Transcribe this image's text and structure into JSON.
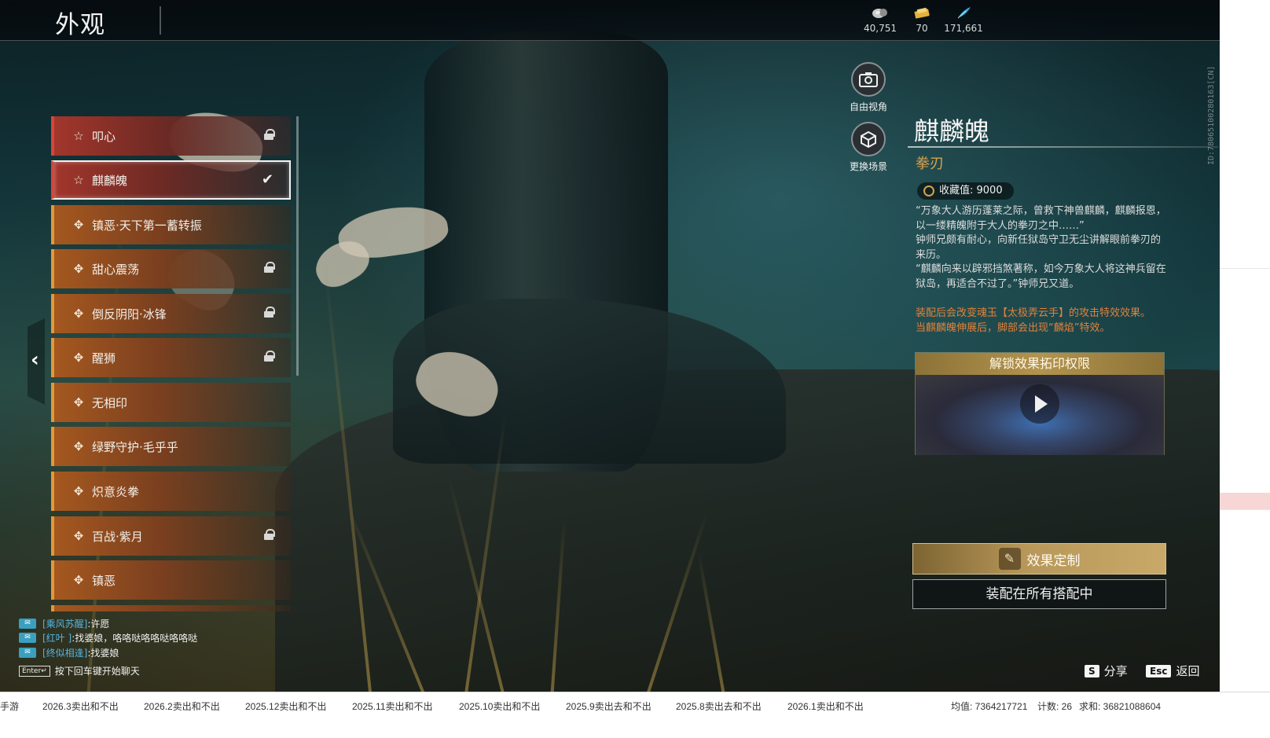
{
  "header": {
    "title": "外观",
    "currencies": [
      {
        "icon": "ore-icon",
        "value": "40,751"
      },
      {
        "icon": "ticket-icon",
        "value": "70"
      },
      {
        "icon": "feather-icon",
        "value": "171,661"
      }
    ]
  },
  "side_id": "ID:78065100280163[CN]",
  "skin_list": [
    {
      "label": "叩心",
      "icon": "star-icon",
      "rarity": "red",
      "locked": true
    },
    {
      "label": "麒麟魄",
      "icon": "star-icon",
      "rarity": "red",
      "selected": true,
      "equipped": true
    },
    {
      "label": "镇恶·天下第一蓄转振",
      "icon": "sparkle-icon",
      "rarity": "orange"
    },
    {
      "label": "甜心震荡",
      "icon": "sparkle-icon",
      "rarity": "orange",
      "locked": true
    },
    {
      "label": "倒反阴阳·冰锋",
      "icon": "sparkle-icon",
      "rarity": "orange",
      "locked": true
    },
    {
      "label": "醒狮",
      "icon": "sparkle-icon",
      "rarity": "orange",
      "locked": true
    },
    {
      "label": "无相印",
      "icon": "sparkle-icon",
      "rarity": "orange"
    },
    {
      "label": "绿野守护·毛乎乎",
      "icon": "sparkle-icon",
      "rarity": "orange"
    },
    {
      "label": "炽意炎拳",
      "icon": "sparkle-icon",
      "rarity": "orange"
    },
    {
      "label": "百战·紫月",
      "icon": "sparkle-icon",
      "rarity": "orange",
      "locked": true
    },
    {
      "label": "镇恶",
      "icon": "sparkle-icon",
      "rarity": "orange"
    }
  ],
  "camera": {
    "free_view_label": "自由视角",
    "change_scene_label": "更换场景"
  },
  "detail": {
    "name": "麒麟魄",
    "type": "拳刃",
    "collect_label": "收藏值: 9000",
    "description": [
      "“万象大人游历蓬莱之际，曾救下神兽麒麟，麒麟报恩，以一缕精魄附于大人的拳刃之中……”",
      "钟师兄颇有耐心，向新任狱岛守卫无尘讲解眼前拳刃的来历。",
      "“麒麟向来以辟邪挡煞著称，如今万象大人将这神兵留在狱岛，再适合不过了。”钟师兄又道。"
    ],
    "effects": [
      "装配后会改变魂玉【太极弄云手】的攻击特效效果。",
      "当麒麟魄伸展后，脚部会出现“麟焰”特效。"
    ],
    "preview_header": "解锁效果拓印权限"
  },
  "buttons": {
    "customize": "效果定制",
    "equip_all": "装配在所有搭配中"
  },
  "chat": {
    "lines": [
      {
        "name": "[乘风苏醒]",
        "text": ":许愿"
      },
      {
        "name": "[红叶 ]",
        "text": ":找婆娘，咯咯哒咯咯哒咯咯哒"
      },
      {
        "name": "[终似相逢]",
        "text": ":找婆娘"
      }
    ],
    "enter_key": "Enter↵",
    "hint": "按下回车键开始聊天"
  },
  "hotkeys": {
    "share_key": "S",
    "share_label": "分享",
    "back_key": "Esc",
    "back_label": "返回"
  },
  "sheet": {
    "tabs": [
      "手游",
      "2026.3卖出和不出",
      "2026.2卖出和不出",
      "2025.12卖出和不出",
      "2025.11卖出和不出",
      "2025.10卖出和不出",
      "2025.9卖出去和不出",
      "2025.8卖出去和不出",
      "2026.1卖出和不出"
    ],
    "status_avg": "均值: 7364217721",
    "status_count": "计数: 26",
    "status_sum": "求和: 36821088604"
  }
}
